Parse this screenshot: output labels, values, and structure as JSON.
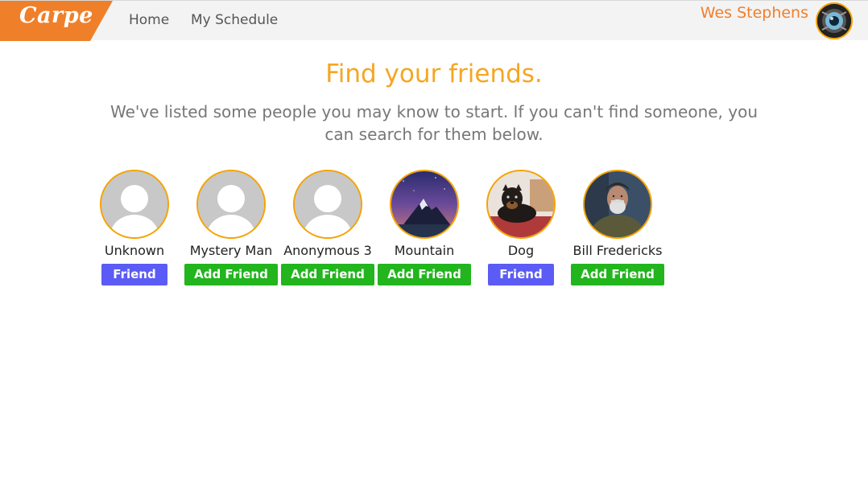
{
  "brand": {
    "logo_text": "Carpe",
    "color": "#f07f2a"
  },
  "nav": {
    "links": [
      "Home",
      "My Schedule"
    ]
  },
  "user": {
    "name": "Wes Stephens",
    "avatar_icon": "webcam-lens-avatar"
  },
  "main": {
    "title": "Find your friends.",
    "subtitle": "We've listed some people you may know to start. If you can't find someone, you can search for them below."
  },
  "colors": {
    "accent": "#f5a623",
    "friend_button": "#5b5bf5",
    "add_button": "#22b51d",
    "avatar_border": "#f5a300"
  },
  "friends": [
    {
      "name": "Unknown",
      "button": "Friend",
      "status": "friend",
      "avatar": "default-person-icon"
    },
    {
      "name": "Mystery Man",
      "button": "Add Friend",
      "status": "add",
      "avatar": "default-person-icon"
    },
    {
      "name": "Anonymous 3",
      "button": "Add Friend",
      "status": "add",
      "avatar": "default-person-icon"
    },
    {
      "name": "Mountain",
      "button": "Add Friend",
      "status": "add",
      "avatar": "mountain-photo"
    },
    {
      "name": "Dog",
      "button": "Friend",
      "status": "friend",
      "avatar": "dog-photo"
    },
    {
      "name": "Bill Fredericks",
      "button": "Add Friend",
      "status": "add",
      "avatar": "old-man-photo"
    }
  ]
}
